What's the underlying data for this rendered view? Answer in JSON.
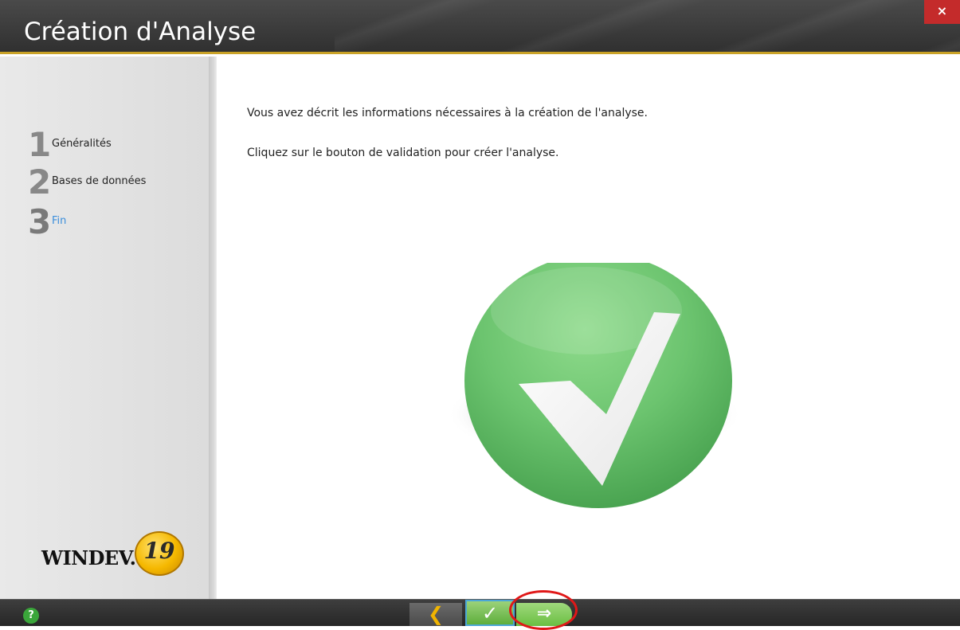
{
  "window": {
    "title": "Création d'Analyse",
    "close_label": "×"
  },
  "sidebar": {
    "steps": [
      {
        "number": "1",
        "label": "Généralités",
        "active": false
      },
      {
        "number": "2",
        "label": "Bases de données",
        "active": false
      },
      {
        "number": "3",
        "label": "Fin",
        "active": true
      }
    ],
    "logo": {
      "text": "WINDEV.",
      "version": "19"
    }
  },
  "content": {
    "message_line1": "Vous avez décrit les informations nécessaires à la création de l'analyse.",
    "message_line2": "Cliquez sur le bouton de validation pour créer l'analyse.",
    "illustration": "check-mark-icon"
  },
  "footer": {
    "help_label": "?",
    "prev_label": "❮",
    "validate_label": "✓",
    "next_label": "⇒"
  },
  "colors": {
    "titlebar": "#3a3a3a",
    "accent": "#c9a227",
    "active_step": "#3b8edc",
    "check_green": "#6cc46f",
    "close_red": "#c42b2b",
    "highlight": "#e01818"
  }
}
